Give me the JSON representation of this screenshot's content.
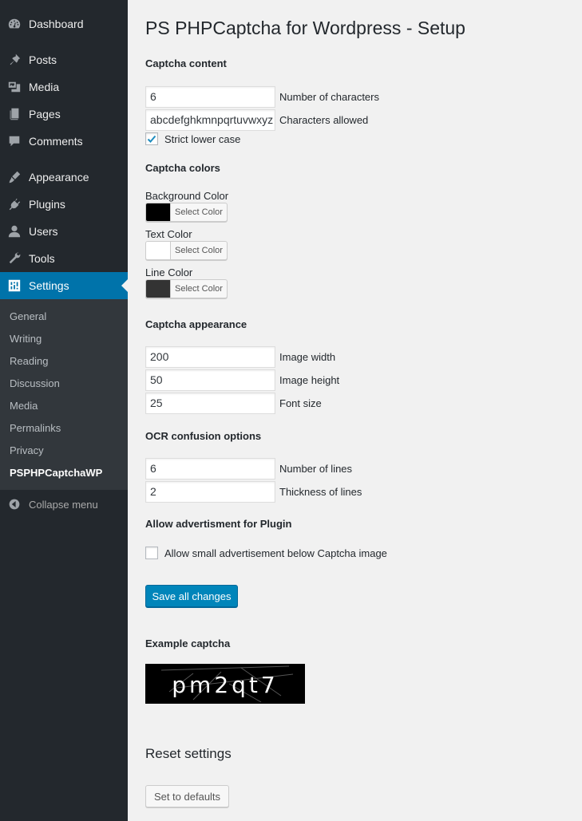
{
  "sidebar": {
    "items": [
      {
        "label": "Dashboard",
        "icon": "dashboard-icon"
      },
      {
        "label": "Posts",
        "icon": "pin-icon"
      },
      {
        "label": "Media",
        "icon": "media-icon"
      },
      {
        "label": "Pages",
        "icon": "pages-icon"
      },
      {
        "label": "Comments",
        "icon": "comment-icon"
      },
      {
        "label": "Appearance",
        "icon": "brush-icon"
      },
      {
        "label": "Plugins",
        "icon": "plug-icon"
      },
      {
        "label": "Users",
        "icon": "user-icon"
      },
      {
        "label": "Tools",
        "icon": "wrench-icon"
      },
      {
        "label": "Settings",
        "icon": "settings-icon"
      }
    ],
    "submenu": [
      "General",
      "Writing",
      "Reading",
      "Discussion",
      "Media",
      "Permalinks",
      "Privacy",
      "PSPHPCaptchaWP"
    ],
    "collapse_label": "Collapse menu"
  },
  "page": {
    "title": "PS PHPCaptcha for Wordpress - Setup",
    "content": {
      "heading": "Captcha content",
      "num_chars_value": "6",
      "num_chars_label": "Number of characters",
      "chars_allowed_value": "abcdefghkmnpqrtuvwxyz",
      "chars_allowed_label": "Characters allowed",
      "strict_lower_label": "Strict lower case",
      "strict_lower_checked": true
    },
    "colors": {
      "heading": "Captcha colors",
      "background_label": "Background Color",
      "background_color": "#000000",
      "text_label": "Text Color",
      "text_color": "#ffffff",
      "line_label": "Line Color",
      "line_color": "#333333",
      "select_label": "Select Color"
    },
    "appearance": {
      "heading": "Captcha appearance",
      "width_value": "200",
      "width_label": "Image width",
      "height_value": "50",
      "height_label": "Image height",
      "font_size_value": "25",
      "font_size_label": "Font size"
    },
    "ocr": {
      "heading": "OCR confusion options",
      "lines_value": "6",
      "lines_label": "Number of lines",
      "thickness_value": "2",
      "thickness_label": "Thickness of lines"
    },
    "advert": {
      "heading": "Allow advertisment for Plugin",
      "checkbox_label": "Allow small advertisement below Captcha image",
      "checked": false
    },
    "save_button": "Save all changes",
    "example": {
      "heading": "Example captcha",
      "captcha_text": "pm2qt7"
    },
    "reset": {
      "heading": "Reset settings",
      "button": "Set to defaults"
    }
  }
}
